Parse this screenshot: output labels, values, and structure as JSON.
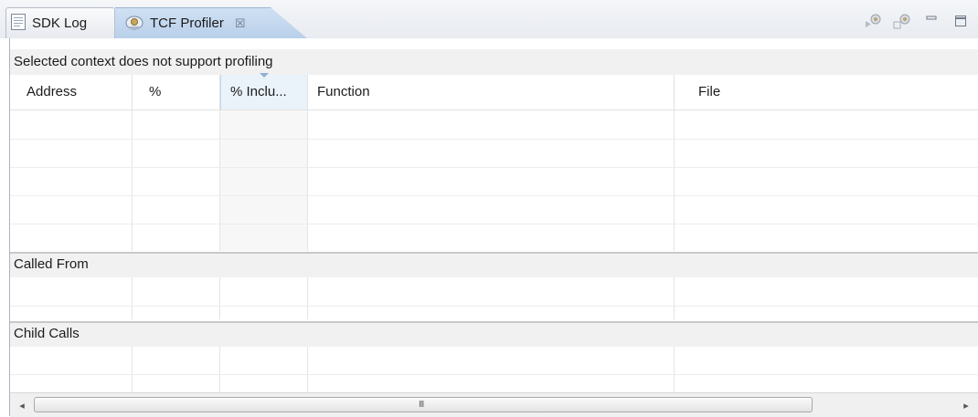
{
  "tabs": [
    {
      "label": "SDK Log",
      "icon": "log-icon",
      "active": false
    },
    {
      "label": "TCF Profiler",
      "icon": "profiler-icon",
      "active": true,
      "close_glyph": "☒"
    }
  ],
  "toolbar": {
    "icons": [
      "profiler-start-icon",
      "profiler-configure-icon",
      "minimize-icon",
      "maximize-icon"
    ]
  },
  "status_message": "Selected context does not support profiling",
  "table": {
    "columns": [
      "Address",
      "%",
      "% Inclu...",
      "Function",
      "File"
    ],
    "sorted_column": "% Inclu...",
    "rows": []
  },
  "sections": {
    "called_from": "Called From",
    "child_calls": "Child Calls"
  },
  "scrollbar": {
    "left": "◂",
    "right": "▸",
    "grip": "III"
  },
  "colors": {
    "active_tab": "#c4d8ee",
    "sorted_column": "#eaf2fa",
    "section_bar": "#f1f1f1"
  }
}
